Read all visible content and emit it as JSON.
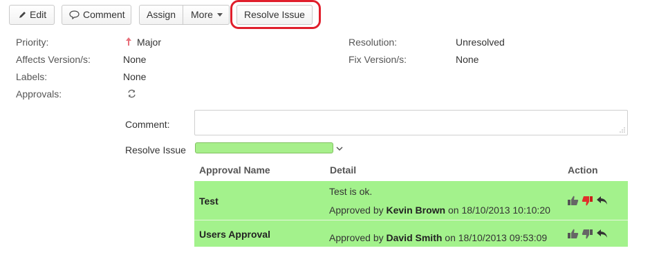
{
  "toolbar": {
    "edit_label": "Edit",
    "comment_label": "Comment",
    "assign_label": "Assign",
    "more_label": "More",
    "resolve_label": "Resolve Issue"
  },
  "fields": {
    "priority_label": "Priority:",
    "priority_value": "Major",
    "affects_label": "Affects Version/s:",
    "affects_value": "None",
    "labels_label": "Labels:",
    "labels_value": "None",
    "approvals_label": "Approvals:",
    "resolution_label": "Resolution:",
    "resolution_value": "Unresolved",
    "fix_label": "Fix Version/s:",
    "fix_value": "None"
  },
  "form": {
    "comment_label": "Comment:",
    "comment_value": "",
    "resolve_label": "Resolve Issue",
    "resolve_value": ""
  },
  "table": {
    "headers": {
      "name": "Approval Name",
      "detail": "Detail",
      "action": "Action"
    },
    "rows": [
      {
        "name": "Test",
        "note": "Test is ok.",
        "approved_prefix": "Approved by",
        "approver": "Kevin Brown",
        "on": "on",
        "date": "18/10/2013 10:10:20"
      },
      {
        "name": "Users Approval",
        "approved_prefix": "Approved by",
        "approver": "David Smith",
        "on": "on",
        "date": "18/10/2013 09:53:09"
      }
    ]
  },
  "colors": {
    "row_green": "#a3f28c",
    "highlight_red": "#e01e2b",
    "reject_red": "#e0302a"
  }
}
